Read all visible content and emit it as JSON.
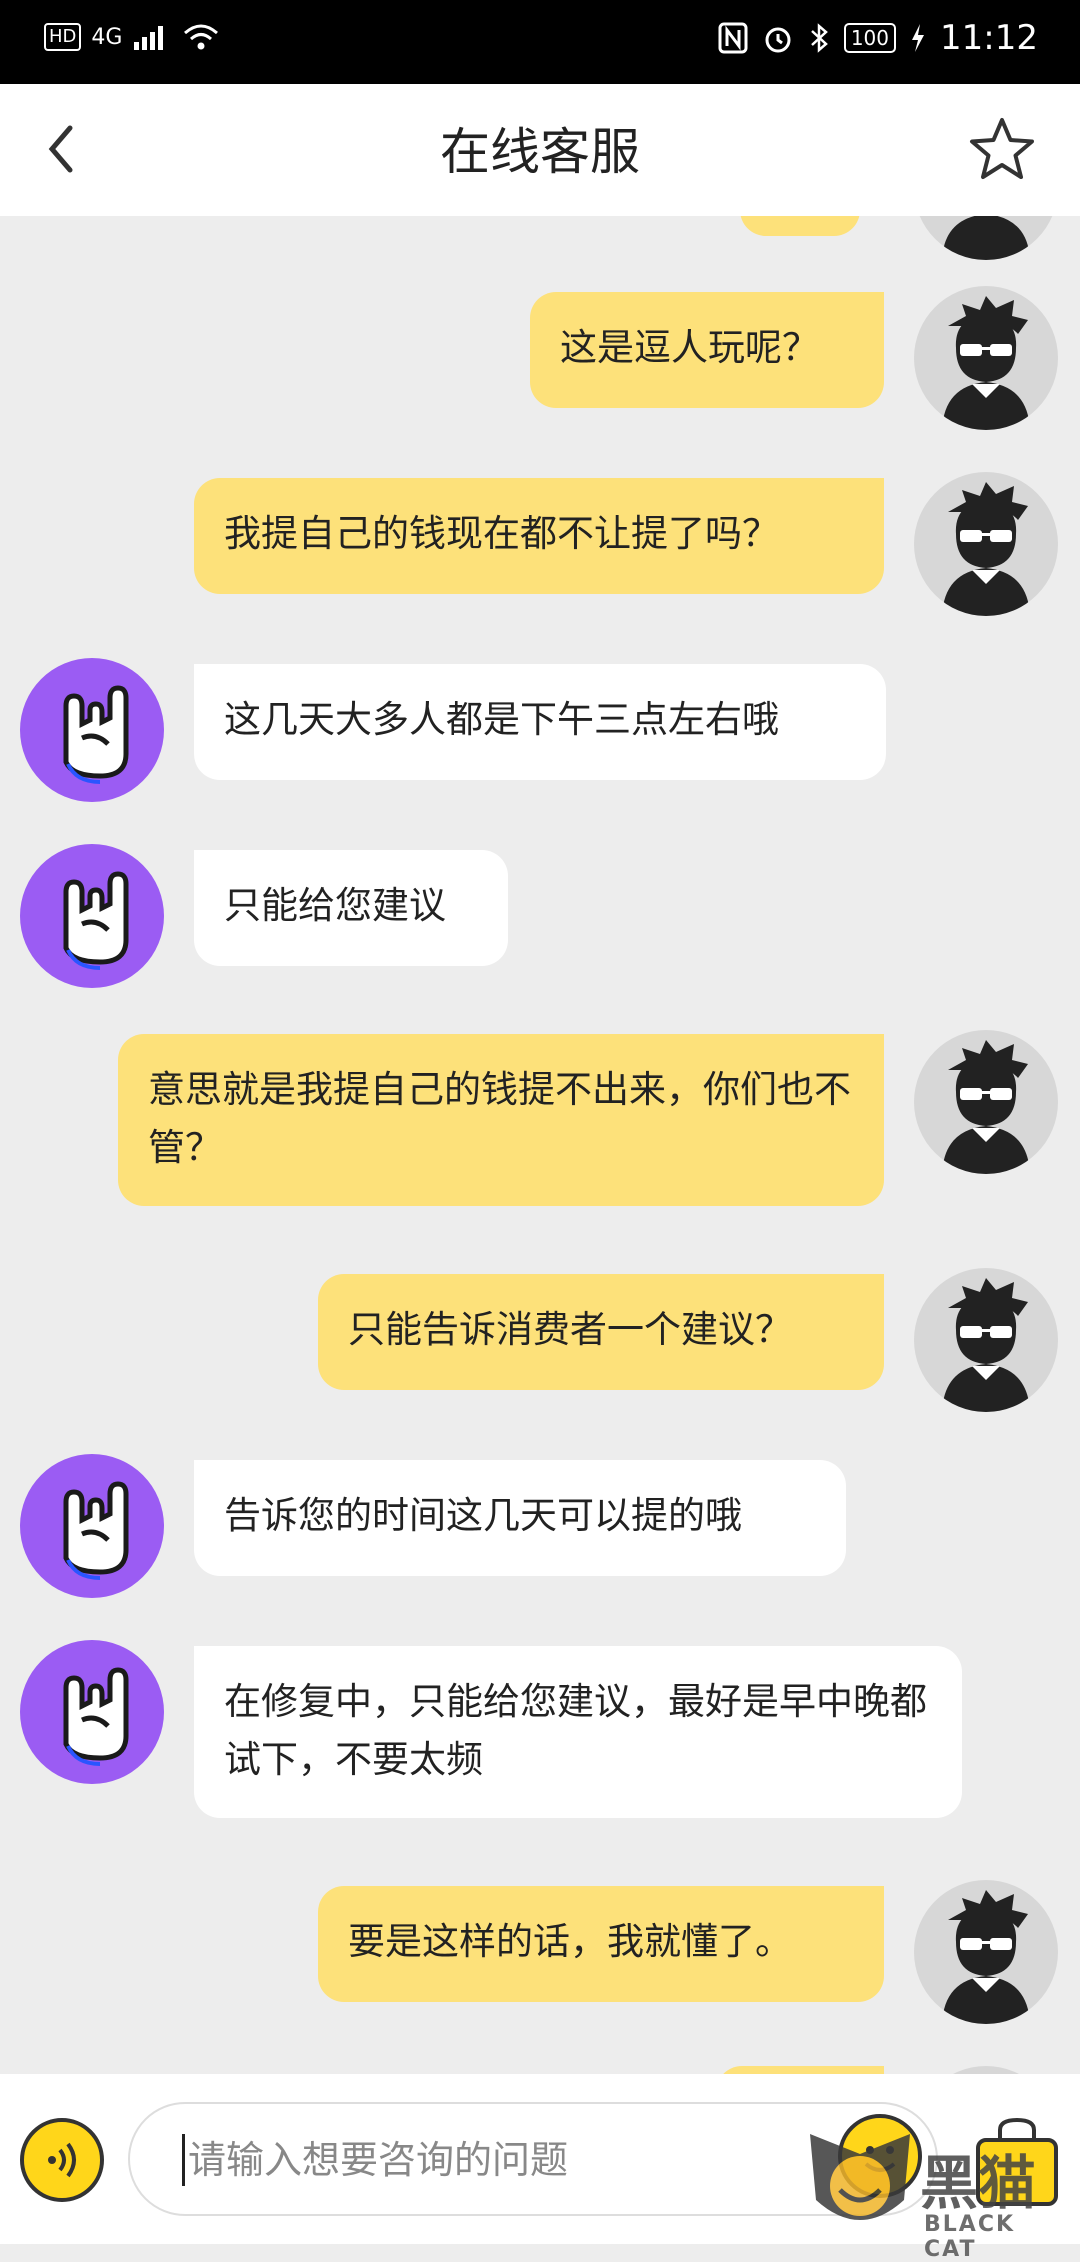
{
  "status_bar": {
    "network": "4G",
    "hd_badge": "HD",
    "battery": "100",
    "time": "11:12"
  },
  "header": {
    "title": "在线客服"
  },
  "messages": [
    {
      "from": "user",
      "text": "这是逗人玩呢？"
    },
    {
      "from": "user",
      "text": "我提自己的钱现在都不让提了吗？"
    },
    {
      "from": "agent",
      "text": "这几天大多人都是下午三点左右哦"
    },
    {
      "from": "agent",
      "text": "只能给您建议"
    },
    {
      "from": "user",
      "text": "意思就是我提自己的钱提不出来，你们也不管？"
    },
    {
      "from": "user",
      "text": "只能告诉消费者一个建议？"
    },
    {
      "from": "agent",
      "text": "告诉您的时间这几天可以提的哦"
    },
    {
      "from": "agent",
      "text": "在修复中，只能给您建议，最好是早中晚都试下，不要太频"
    },
    {
      "from": "user",
      "text": "要是这样的话，我就懂了。"
    }
  ],
  "input": {
    "placeholder": "请输入想要咨询的问题"
  },
  "watermark": {
    "cn": "黑猫",
    "en": "BLACK CAT"
  },
  "colors": {
    "user_bubble": "#fde17a",
    "agent_bubble": "#ffffff",
    "agent_avatar": "#9b5cf3",
    "background": "#ededed"
  },
  "icons": {
    "back": "chevron-left-icon",
    "favorite": "star-icon",
    "voice": "voice-icon",
    "emoji": "emoji-icon",
    "more": "bag-icon"
  }
}
